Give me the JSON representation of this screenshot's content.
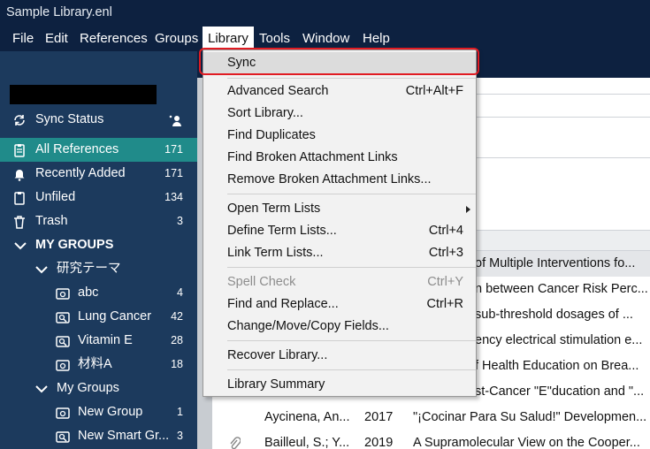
{
  "window": {
    "title": "Sample Library.enl"
  },
  "menubar": {
    "items": [
      "File",
      "Edit",
      "References",
      "Groups",
      "Library",
      "Tools",
      "Window",
      "Help"
    ],
    "active": "Library"
  },
  "sidebar": {
    "sync_status": "Sync Status",
    "items": [
      {
        "label": "All References",
        "count": "171"
      },
      {
        "label": "Recently Added",
        "count": "171"
      },
      {
        "label": "Unfiled",
        "count": "134"
      },
      {
        "label": "Trash",
        "count": "3"
      }
    ],
    "my_groups": "MY GROUPS",
    "group_set_1": "研究テーマ",
    "group_set_1_items": [
      {
        "label": "abc",
        "count": "4"
      },
      {
        "label": "Lung Cancer",
        "count": "42"
      },
      {
        "label": "Vitamin E",
        "count": "28"
      },
      {
        "label": "材料A",
        "count": "18"
      }
    ],
    "group_set_2": "My Groups",
    "group_set_2_items": [
      {
        "label": "New Group",
        "count": "1"
      },
      {
        "label": "New Smart Gr...",
        "count": "3"
      }
    ]
  },
  "references": {
    "partial_rows": [
      "of Multiple Interventions fo...",
      "n between Cancer Risk Perc...",
      "sub-threshold dosages of ...",
      "ency electrical stimulation e...",
      "f Health Education on Brea...",
      "st-Cancer \"E\"ducation and \"..."
    ],
    "rows": [
      {
        "author": "Aycinena, An...",
        "year": "2017",
        "title": "\"¡Cocinar Para Su Salud!\" Developmen..."
      },
      {
        "author": "Bailleul, S.; Y...",
        "year": "2019",
        "title": "A Supramolecular View on the Cooper..."
      }
    ]
  },
  "library_menu": {
    "sync": "Sync",
    "advanced_search": "Advanced Search",
    "advanced_search_shortcut": "Ctrl+Alt+F",
    "sort_library": "Sort Library...",
    "find_duplicates": "Find Duplicates",
    "find_broken": "Find Broken Attachment Links",
    "remove_broken": "Remove Broken Attachment Links...",
    "open_term_lists": "Open Term Lists",
    "define_term_lists": "Define Term Lists...",
    "define_term_lists_shortcut": "Ctrl+4",
    "link_term_lists": "Link Term Lists...",
    "link_term_lists_shortcut": "Ctrl+3",
    "spell_check": "Spell Check",
    "spell_check_shortcut": "Ctrl+Y",
    "find_replace": "Find and Replace...",
    "find_replace_shortcut": "Ctrl+R",
    "change_fields": "Change/Move/Copy Fields...",
    "recover_library": "Recover Library...",
    "library_summary": "Library Summary"
  },
  "colors": {
    "titlebar": "#0d2140",
    "sidebar": "#1c3a5d",
    "selected": "#208b8a",
    "highlight_ring": "#e11b22"
  }
}
